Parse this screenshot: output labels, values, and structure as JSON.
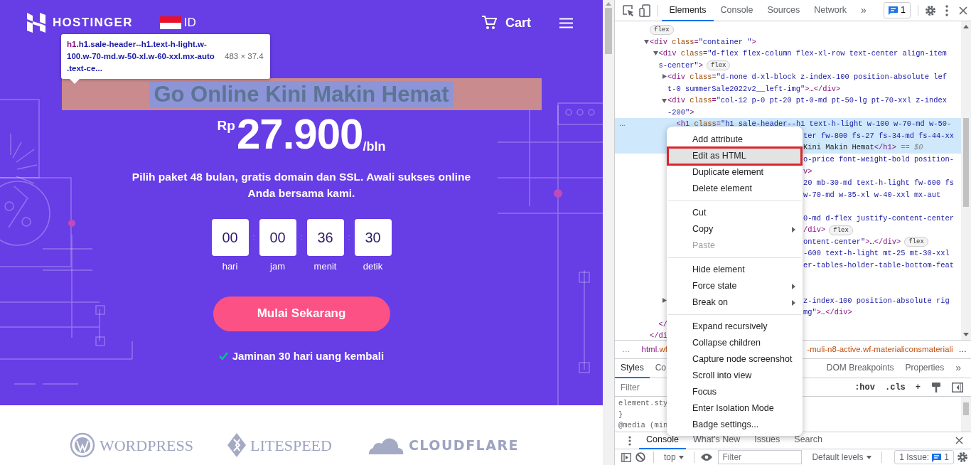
{
  "page": {
    "header": {
      "logo": "HOSTINGER",
      "language": "ID",
      "cart": "Cart"
    },
    "inspect_tooltip": {
      "tag": "h1",
      "classes": ".h1.sale-header--h1.text-h-light.w-100.w-70-md.w-50-xl.w-60-xxl.mx-auto.text-ce...",
      "size": "483 × 37.4"
    },
    "headline": "Go Online Kini Makin Hemat",
    "price": {
      "currency": "Rp",
      "amount": "27.900",
      "period": "/bln"
    },
    "subtitle": "Pilih paket 48 bulan, gratis domain dan SSL. Awali sukses online Anda bersama kami.",
    "countdown": [
      {
        "value": "00",
        "unit": "hari"
      },
      {
        "value": "00",
        "unit": "jam"
      },
      {
        "value": "36",
        "unit": "menit"
      },
      {
        "value": "30",
        "unit": "detik"
      }
    ],
    "countdown_separator": ":",
    "cta": "Mulai Sekarang",
    "guarantee": "Jaminan 30 hari uang kembali",
    "partners": [
      {
        "kind": "circle",
        "name": "WORDPRESS"
      },
      {
        "kind": "diamond",
        "name": "LITESPEED"
      },
      {
        "kind": "cloud",
        "name": "CLOUDFLARE"
      }
    ]
  },
  "devtools": {
    "tabs": [
      {
        "label": "Elements",
        "selected": true
      },
      {
        "label": "Console",
        "selected": false
      },
      {
        "label": "Sources",
        "selected": false
      },
      {
        "label": "Network",
        "selected": false
      }
    ],
    "more_tabs": "»",
    "issues_count": "1",
    "dom_tree": [
      {
        "selected": false,
        "lines": [
          {
            "kind": "full",
            "badge": "flex"
          }
        ]
      },
      {
        "selected": false,
        "expanded": true,
        "lines": [
          {
            "kind": "full",
            "parts": [
              {
                "tag": "<div"
              },
              {
                "attr": " class"
              },
              {
                "tag": "="
              },
              {
                "value": "\"container  \""
              },
              {
                "tag": ">"
              }
            ]
          }
        ],
        "children": [
          {
            "selected": false,
            "expanded": true,
            "lines": [
              {
                "kind": "full",
                "parts": [
                  {
                    "tag": "<div"
                  },
                  {
                    "attr": " class"
                  },
                  {
                    "tag": "="
                  },
                  {
                    "value": "\"d-flex flex-column flex-xl-row text-center align-item"
                  }
                ]
              },
              {
                "kind": "full",
                "parts": [
                  {
                    "value": "s-center\""
                  },
                  {
                    "tag": ">"
                  }
                ],
                "badge": "flex"
              }
            ],
            "children": [
              {
                "selected": false,
                "expanded": false,
                "lines": [
                  {
                    "kind": "full",
                    "parts": [
                      {
                        "tag": "<div"
                      },
                      {
                        "attr": " class"
                      },
                      {
                        "tag": "="
                      },
                      {
                        "value": "\"d-none d-xl-block z-index-100 position-absolute lef"
                      }
                    ]
                  },
                  {
                    "kind": "full",
                    "parts": [
                      {
                        "value": "t-0 summerSale2022v2__left-img\""
                      },
                      {
                        "tag": ">"
                      },
                      {
                        "text": "…"
                      },
                      {
                        "tag": "</div>"
                      }
                    ]
                  }
                ]
              },
              {
                "selected": false,
                "expanded": true,
                "lines": [
                  {
                    "kind": "full",
                    "parts": [
                      {
                        "tag": "<div"
                      },
                      {
                        "attr": " class"
                      },
                      {
                        "tag": "="
                      },
                      {
                        "value": "\"col-12 p-0 pt-20 pt-0-md pt-50-lg pt-70-xxl z-index"
                      }
                    ]
                  },
                  {
                    "kind": "full",
                    "parts": [
                      {
                        "value": "-200\""
                      },
                      {
                        "tag": ">"
                      }
                    ]
                  }
                ],
                "children": [
                  {
                    "selected": true,
                    "gutter": "...",
                    "lines": [
                      {
                        "kind": "full",
                        "parts": [
                          {
                            "tag": "<h1"
                          },
                          {
                            "attr": " class"
                          },
                          {
                            "tag": "="
                          },
                          {
                            "value": "\"h1 sale-header--h1 text-h-light w-100 w-70-md w-50-"
                          }
                        ]
                      },
                      {
                        "kind": "tail",
                        "parts": [
                          {
                            "value": "ter fw-800 fs-27 fs-34-md fs-44-xx"
                          }
                        ]
                      },
                      {
                        "kind": "tail",
                        "parts": [
                          {
                            "text": "Kini Makin Hemat"
                          },
                          {
                            "tag": "</h1>"
                          },
                          {
                            "dim": " == $0"
                          }
                        ]
                      }
                    ]
                  },
                  {
                    "selected": false,
                    "lines": [
                      {
                        "kind": "tail",
                        "parts": [
                          {
                            "value": "o-price font-weight-bold position-"
                          }
                        ]
                      },
                      {
                        "kind": "tail",
                        "parts": [
                          {
                            "tag": "v>"
                          }
                        ]
                      }
                    ]
                  },
                  {
                    "selected": false,
                    "lines": [
                      {
                        "kind": "tail",
                        "parts": [
                          {
                            "value": "20 mb-30-md text-h-light fw-600 fs"
                          }
                        ]
                      },
                      {
                        "kind": "tail",
                        "parts": [
                          {
                            "value": "w-70-md w-35-xl w-40-xxl mx-aut"
                          }
                        ]
                      },
                      {
                        "kind": "covered"
                      }
                    ]
                  },
                  {
                    "selected": false,
                    "lines": [
                      {
                        "kind": "tail",
                        "parts": [
                          {
                            "value": "0-md d-flex justify-content-center"
                          }
                        ]
                      },
                      {
                        "kind": "tail",
                        "parts": [
                          {
                            "tag": "/div>"
                          }
                        ],
                        "badge": "flex"
                      }
                    ]
                  },
                  {
                    "selected": false,
                    "lines": [
                      {
                        "kind": "tail",
                        "parts": [
                          {
                            "value": "ontent-center\""
                          },
                          {
                            "tag": ">"
                          },
                          {
                            "text": "…"
                          },
                          {
                            "tag": "</div>"
                          }
                        ],
                        "badge": "flex"
                      }
                    ]
                  },
                  {
                    "selected": false,
                    "lines": [
                      {
                        "kind": "tail",
                        "parts": [
                          {
                            "value": "-600 text-h-light mt-25 mt-30-xxl"
                          }
                        ]
                      },
                      {
                        "kind": "tail",
                        "parts": [
                          {
                            "value": "er-tables-holder-table-bottom-feat"
                          }
                        ]
                      },
                      {
                        "kind": "covered"
                      },
                      {
                        "kind": "covered"
                      }
                    ]
                  }
                ]
              },
              {
                "selected": false,
                "expanded": false,
                "lines": [
                  {
                    "kind": "tail",
                    "parts": [
                      {
                        "value": "z-index-100 position-absolute rig"
                      }
                    ]
                  },
                  {
                    "kind": "tail",
                    "parts": [
                      {
                        "value": "mg\""
                      },
                      {
                        "tag": ">"
                      },
                      {
                        "text": "…"
                      },
                      {
                        "tag": "</div>"
                      }
                    ]
                  }
                ]
              }
            ],
            "closing": [
              {
                "tag": "</"
              }
            ]
          }
        ],
        "closing": [
          {
            "tag": "</di"
          }
        ]
      }
    ],
    "context_menu": [
      {
        "kind": "item",
        "label": "Add attribute",
        "selected": false,
        "disabled": false,
        "submenu": false,
        "outlined": false
      },
      {
        "kind": "item",
        "label": "Edit as HTML",
        "selected": true,
        "disabled": false,
        "submenu": false,
        "outlined": true
      },
      {
        "kind": "item",
        "label": "Duplicate element",
        "selected": false,
        "disabled": false,
        "submenu": false,
        "outlined": false
      },
      {
        "kind": "item",
        "label": "Delete element",
        "selected": false,
        "disabled": false,
        "submenu": false,
        "outlined": false
      },
      {
        "kind": "separator"
      },
      {
        "kind": "item",
        "label": "Cut",
        "selected": false,
        "disabled": false,
        "submenu": false,
        "outlined": false
      },
      {
        "kind": "item",
        "label": "Copy",
        "selected": false,
        "disabled": false,
        "submenu": true,
        "outlined": false
      },
      {
        "kind": "item",
        "label": "Paste",
        "selected": false,
        "disabled": true,
        "submenu": false,
        "outlined": false
      },
      {
        "kind": "separator"
      },
      {
        "kind": "item",
        "label": "Hide element",
        "selected": false,
        "disabled": false,
        "submenu": false,
        "outlined": false
      },
      {
        "kind": "item",
        "label": "Force state",
        "selected": false,
        "disabled": false,
        "submenu": true,
        "outlined": false
      },
      {
        "kind": "item",
        "label": "Break on",
        "selected": false,
        "disabled": false,
        "submenu": true,
        "outlined": false
      },
      {
        "kind": "separator"
      },
      {
        "kind": "item",
        "label": "Expand recursively",
        "selected": false,
        "disabled": false,
        "submenu": false,
        "outlined": false
      },
      {
        "kind": "item",
        "label": "Collapse children",
        "selected": false,
        "disabled": false,
        "submenu": false,
        "outlined": false
      },
      {
        "kind": "item",
        "label": "Capture node screenshot",
        "selected": false,
        "disabled": false,
        "submenu": false,
        "outlined": false
      },
      {
        "kind": "item",
        "label": "Scroll into view",
        "selected": false,
        "disabled": false,
        "submenu": false,
        "outlined": false
      },
      {
        "kind": "item",
        "label": "Focus",
        "selected": false,
        "disabled": false,
        "submenu": false,
        "outlined": false
      },
      {
        "kind": "item",
        "label": "Enter Isolation Mode",
        "selected": false,
        "disabled": false,
        "submenu": false,
        "outlined": false
      },
      {
        "kind": "item",
        "label": "Badge settings...",
        "selected": false,
        "disabled": false,
        "submenu": false,
        "outlined": false
      }
    ],
    "breadcrumbs": {
      "ellipsis_left": "…",
      "left_tag": "html",
      "left_classes": ".wf",
      "right": "-muli-n8-active.wf-materialiconsmateriali",
      "ellipsis_right": "…"
    },
    "styles_tabs": [
      {
        "label": "Styles",
        "selected": true
      },
      {
        "label": "Co",
        "selected": false
      },
      {
        "label": "DOM Breakpoints",
        "selected": false
      },
      {
        "label": "Properties",
        "selected": false
      }
    ],
    "styles_more": "»",
    "styles_filter": {
      "placeholder": "Filter"
    },
    "styles_buttons": [
      ":hov",
      ".cls",
      "+"
    ],
    "styles_rules": [
      "element.sty",
      "}",
      "@media (min"
    ],
    "drawer_tabs": [
      {
        "label": "Console",
        "selected": true
      },
      {
        "label": "What's New",
        "selected": false
      },
      {
        "label": "Issues",
        "selected": false
      },
      {
        "label": "Search",
        "selected": false
      }
    ],
    "console_toolbar": {
      "context": "top",
      "filter_placeholder": "Filter",
      "levels": "Default levels",
      "issues_label": "1 Issue:",
      "issues_count": "1"
    }
  }
}
